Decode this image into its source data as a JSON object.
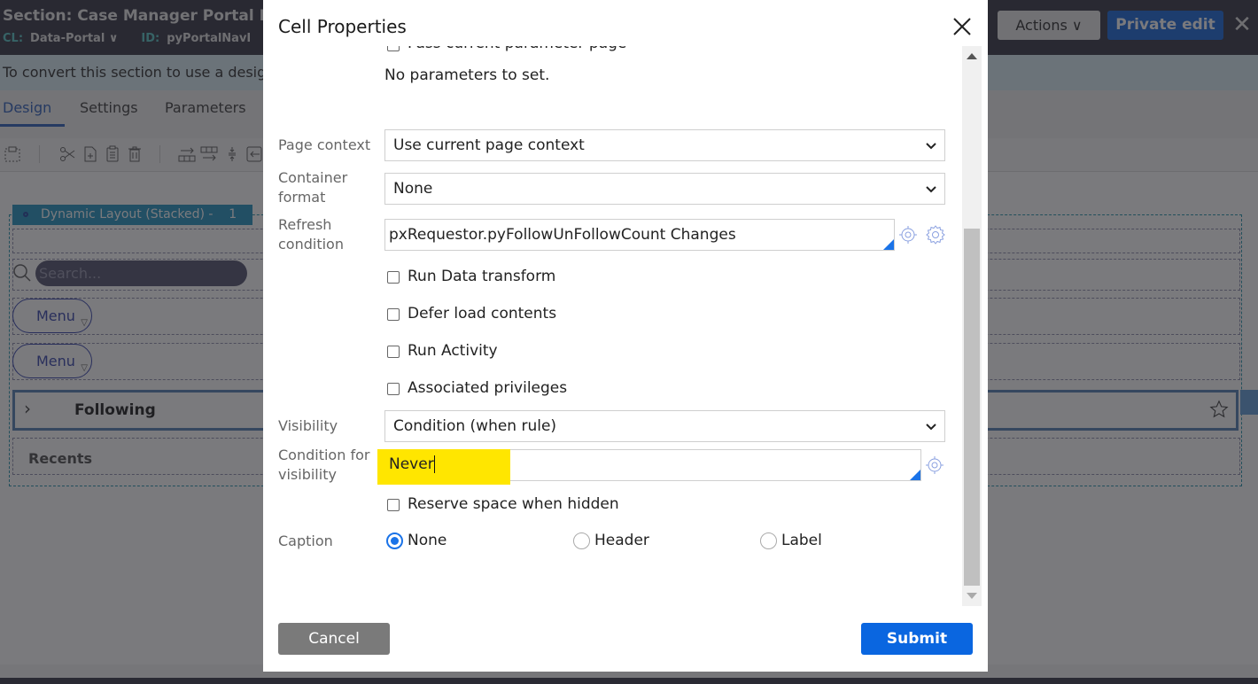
{
  "app": {
    "title": "Section: Case Manager Portal Navig",
    "meta": [
      {
        "key": "CL:",
        "value": "Data-Portal ∨"
      },
      {
        "key": "ID:",
        "value": "pyPortalNavI"
      }
    ],
    "actions_label": "Actions ∨",
    "private_edit_label": "Private edit",
    "close_icon": "✕"
  },
  "banner": {
    "text": "To convert this section to use a design"
  },
  "tabs": [
    {
      "label": "Design",
      "active": true
    },
    {
      "label": "Settings",
      "active": false
    },
    {
      "label": "Parameters",
      "active": false
    }
  ],
  "toolbar": {
    "icons": [
      "select-layout-icon",
      "cut-icon",
      "add-file-icon",
      "paste-icon",
      "delete-icon",
      "insert-row-icon",
      "insert-column-icon",
      "move-icon",
      "back-icon"
    ]
  },
  "canvas": {
    "layout_label": "Dynamic Layout (Stacked) -",
    "layout_index": "1",
    "search_placeholder": "Search...",
    "menu_1": "Menu",
    "menu_2": "Menu",
    "following_label": "Following",
    "recents_label": "Recents"
  },
  "modal": {
    "title": "Cell Properties",
    "pass_param_label": "Pass current parameter page",
    "no_params_text": "No parameters to set.",
    "page_context": {
      "label": "Page context",
      "value": "Use current page context"
    },
    "container_format": {
      "label_1": "Container",
      "label_2": "format",
      "value": "None"
    },
    "refresh_condition": {
      "label_1": "Refresh",
      "label_2": "condition",
      "value": "pxRequestor.pyFollowUnFollowCount Changes"
    },
    "checkboxes": [
      {
        "label": "Run Data transform",
        "checked": false
      },
      {
        "label": "Defer load contents",
        "checked": false
      },
      {
        "label": "Run Activity",
        "checked": false
      },
      {
        "label": "Associated privileges",
        "checked": false
      }
    ],
    "visibility": {
      "label": "Visibility",
      "value": "Condition (when rule)"
    },
    "condition_for_visibility": {
      "label_1": "Condition for",
      "label_2": "visibility",
      "value": "Never"
    },
    "reserve_space": {
      "label": "Reserve space when hidden",
      "checked": false
    },
    "caption": {
      "label": "Caption",
      "options": [
        {
          "label": "None",
          "selected": true
        },
        {
          "label": "Header",
          "selected": false
        },
        {
          "label": "Label",
          "selected": false
        }
      ]
    },
    "cancel_label": "Cancel",
    "submit_label": "Submit"
  },
  "colors": {
    "accent": "#0a66e0",
    "highlight": "#ffe600",
    "header_bg": "#2a2a3a"
  }
}
